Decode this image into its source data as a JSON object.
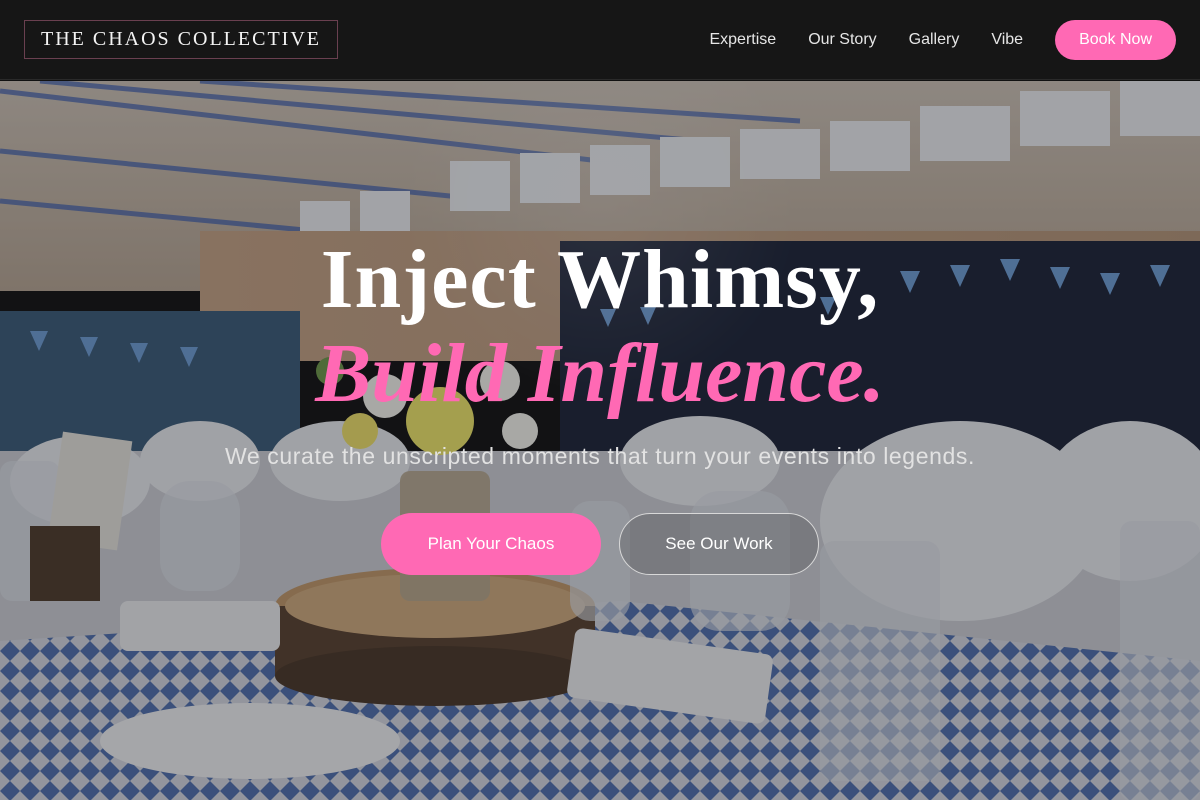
{
  "header": {
    "logo": "THE CHAOS COLLECTIVE",
    "nav": [
      {
        "label": "Expertise"
      },
      {
        "label": "Our Story"
      },
      {
        "label": "Gallery"
      },
      {
        "label": "Vibe"
      }
    ],
    "book_label": "Book Now"
  },
  "hero": {
    "headline_line1": "Inject Whimsy,",
    "headline_line2": "Build Influence.",
    "subtitle": "We curate the unscripted moments that turn your events into legends.",
    "primary_cta": "Plan Your Chaos",
    "secondary_cta": "See Our Work"
  },
  "colors": {
    "accent": "#ff69b4",
    "header_bg": "#161616"
  }
}
